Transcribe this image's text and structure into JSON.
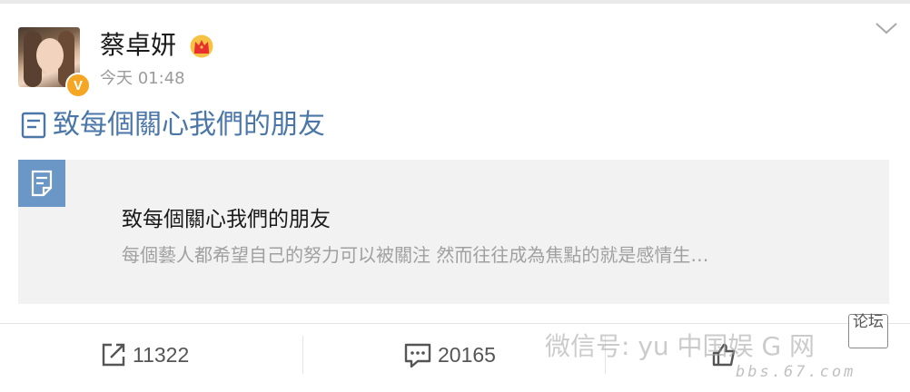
{
  "post": {
    "username": "蔡卓妍",
    "timestamp": "今天 01:48",
    "verified_badge": "V",
    "article_title": "致每個關心我們的朋友"
  },
  "card": {
    "title": "致每個關心我們的朋友",
    "description": "每個藝人都希望自己的努力可以被關注 然而往往成為焦點的就是感情生…"
  },
  "actions": {
    "share_count": "11322",
    "comment_count": "20165"
  },
  "watermark": {
    "text": "微信号: yu 中国娱 G 网",
    "url": "bbs.67.com",
    "stamp": "论坛"
  },
  "icons": {
    "verified": "verified-badge-icon",
    "crown": "crown-icon",
    "dropdown": "chevron-down-icon",
    "article": "article-icon",
    "card": "document-icon",
    "share": "share-icon",
    "comment": "comment-icon",
    "like": "like-icon"
  },
  "colors": {
    "link": "#4a76a8",
    "card_badge": "#6b97c6",
    "verified": "#f5a623"
  }
}
